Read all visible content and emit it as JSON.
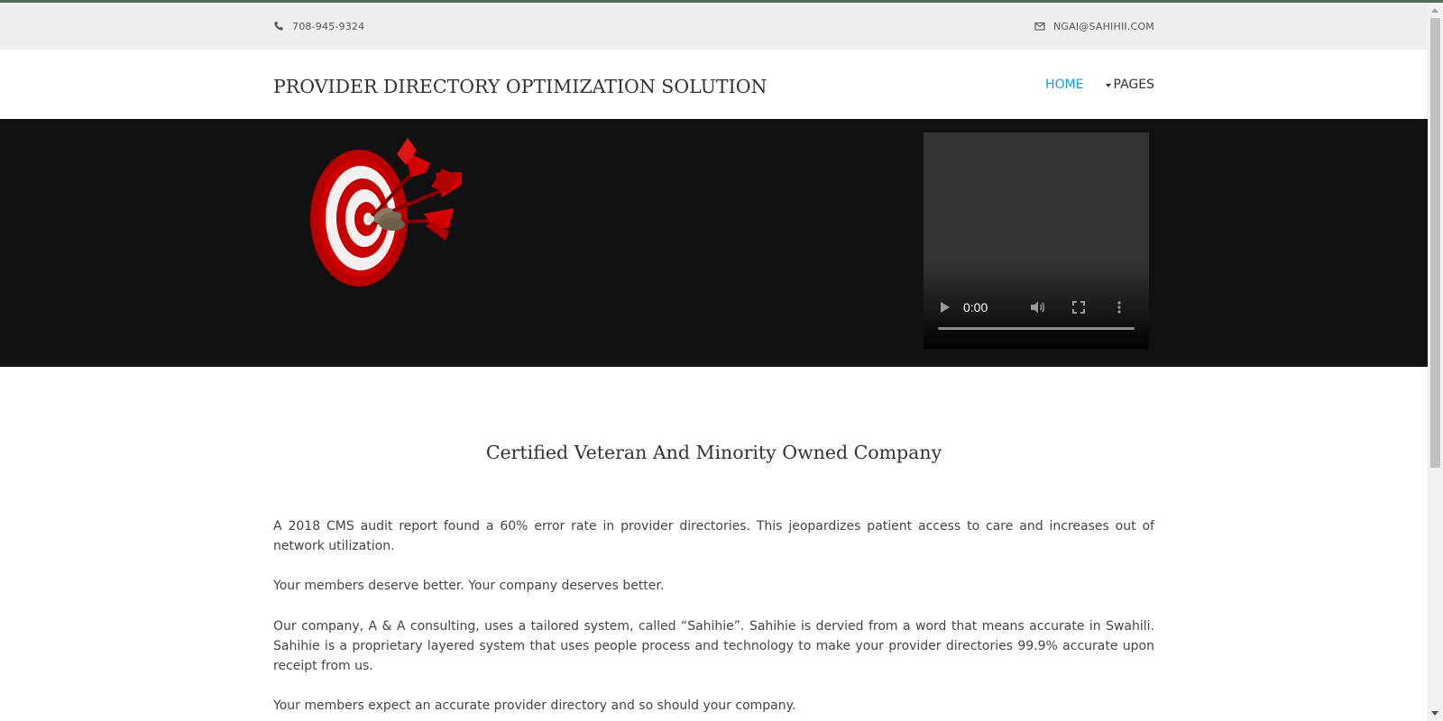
{
  "contact": {
    "phone": "708-945-9324",
    "email": "NGAI@SAHIHII.COM",
    "phone_icon": "phone-icon",
    "email_icon": "envelope-icon"
  },
  "header": {
    "title": "PROVIDER DIRECTORY OPTIMIZATION SOLUTION",
    "nav": {
      "home": "HOME",
      "pages": "PAGES"
    }
  },
  "hero": {
    "image": "dartboard-bullseye-with-darts",
    "video": {
      "time": "0:00",
      "progress": 0
    }
  },
  "main": {
    "heading": "Certified Veteran And Minority Owned Company",
    "paragraphs": [
      "A 2018 CMS audit report found a 60% error rate in provider directories. This jeopardizes patient access to care and increases out of network utilization.",
      "Your members deserve better. Your company deserves better.",
      "Our company, A & A consulting, uses a tailored system, called “Sahihie”. Sahihie is dervied from a word that means accurate in Swahili. Sahihie is a proprietary layered system that uses people process and technology to make your provider directories 99.9% accurate upon receipt from us.",
      "Your members expect an accurate provider directory and so should your company."
    ]
  },
  "colors": {
    "accent": "#1a9bd7",
    "top_bar": "#eeeeee",
    "hero_bg": "#111111",
    "target_red": "#c80000"
  }
}
